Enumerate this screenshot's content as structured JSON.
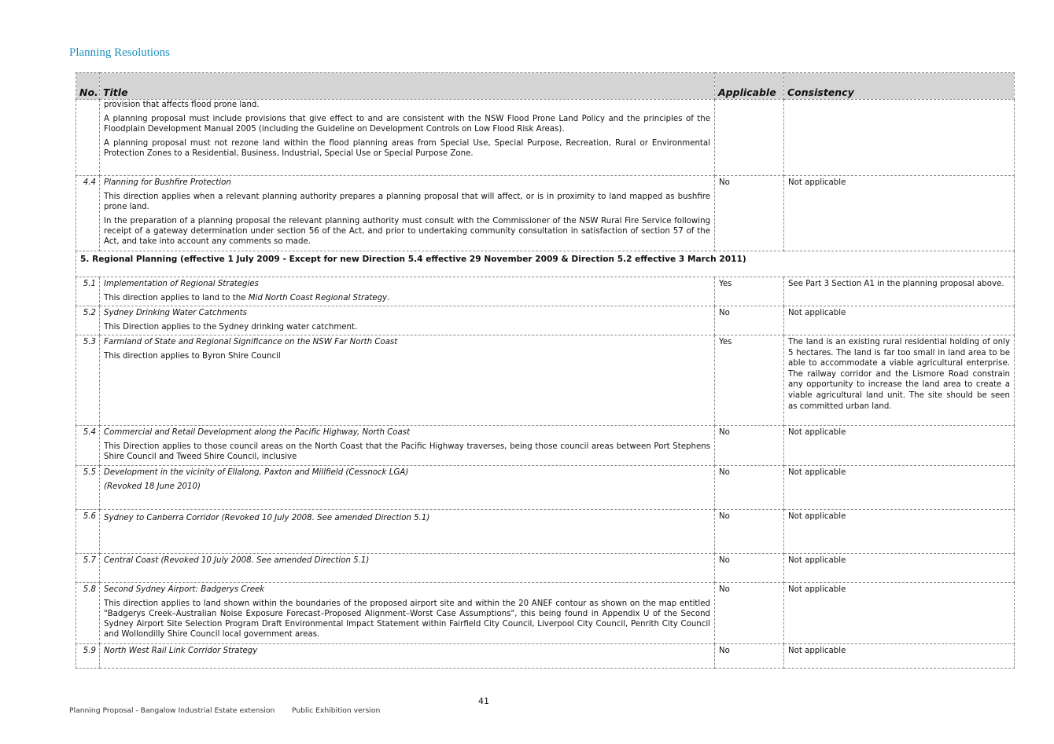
{
  "page_title": "Planning Resolutions",
  "table": {
    "headers": {
      "no": "No.",
      "title": "Title",
      "applicable": "Applicable",
      "consistency": "Consistency"
    },
    "row_cont": {
      "p1": "provision that affects flood prone land.",
      "p2": "A planning proposal must include provisions that give effect to and are consistent with the NSW Flood Prone Land Policy and the principles of the Floodplain Development Manual 2005 (including the Guideline on Development Controls on Low Flood Risk Areas).",
      "p3": "A planning proposal must not rezone land within the flood planning areas from Special Use, Special Purpose, Recreation, Rural or Environmental Protection Zones to a Residential, Business, Industrial, Special Use or Special Purpose Zone."
    },
    "row_4_4": {
      "no": "4.4",
      "heading": "Planning for Bushfire Protection",
      "p1": "This direction applies when a relevant planning authority prepares a planning proposal that will affect, or is in proximity to land mapped as bushfire prone land.",
      "p2": "In the preparation of a planning proposal the relevant planning authority must consult with the Commissioner of the NSW Rural Fire Service following receipt of a gateway determination under section 56 of the Act, and prior to undertaking community consultation in satisfaction of section 57 of the Act, and take into account any comments so made.",
      "applicable": "No",
      "consistency": "Not applicable"
    },
    "section_5": "5. Regional Planning (effective 1 July 2009 - Except for new Direction 5.4 effective 29 November 2009 & Direction 5.2 effective 3 March 2011)",
    "row_5_1": {
      "no": "5.1",
      "heading": "Implementation of Regional Strategies",
      "p1_pre": "This direction applies to land to the ",
      "p1_it": "Mid North Coast Regional Strategy",
      "p1_post": ".",
      "applicable": "Yes",
      "consistency": "See Part 3 Section A1 in the planning proposal above."
    },
    "row_5_2": {
      "no": "5.2",
      "heading": "Sydney Drinking Water Catchments",
      "p1": "This Direction applies to the Sydney drinking water catchment.",
      "applicable": "No",
      "consistency": "Not applicable"
    },
    "row_5_3": {
      "no": "5.3",
      "heading": "Farmland of State and Regional Significance on the NSW Far North Coast",
      "p1": "This direction applies to Byron Shire Council",
      "applicable": "Yes",
      "consistency": "The land is an existing rural residential holding of only 5 hectares. The land is far too small in land area to be able to accommodate a viable agricultural enterprise. The railway corridor and the Lismore Road constrain any opportunity to increase the land area to create a viable agricultural land unit. The site should be seen as committed urban land."
    },
    "row_5_4": {
      "no": "5.4",
      "heading": "Commercial and Retail Development along the Pacific Highway, North Coast",
      "p1": "This Direction applies to those council areas on the North Coast that the Pacific Highway traverses, being those council areas between Port Stephens Shire Council and Tweed Shire Council, inclusive",
      "applicable": "No",
      "consistency": "Not applicable"
    },
    "row_5_5": {
      "no": "5.5",
      "heading": "Development in the vicinity of Ellalong, Paxton and Millfield (Cessnock LGA)",
      "p1": "(Revoked 18 June 2010)",
      "applicable": "No",
      "consistency": "Not applicable"
    },
    "row_5_6": {
      "no": "5.6",
      "heading": "Sydney to Canberra Corridor (Revoked 10 July 2008. See amended Direction 5.1)",
      "applicable": "No",
      "consistency": "Not applicable"
    },
    "row_5_7": {
      "no": "5.7",
      "heading": "Central Coast (Revoked 10 July 2008. See amended Direction 5.1)",
      "applicable": "No",
      "consistency": "Not applicable"
    },
    "row_5_8": {
      "no": "5.8",
      "heading": "Second Sydney Airport: Badgerys Creek",
      "p1": "This direction applies to land shown within the boundaries of the proposed airport site and within the 20 ANEF contour as shown on the map entitled \"Badgerys Creek–Australian Noise Exposure Forecast–Proposed Alignment–Worst Case Assumptions\", this being found in Appendix U of the Second Sydney Airport Site Selection Program Draft Environmental Impact Statement within Fairfield City Council, Liverpool City Council, Penrith City Council and Wollondilly Shire Council local government areas.",
      "applicable": "No",
      "consistency": "Not applicable"
    },
    "row_5_9": {
      "no": "5.9",
      "heading": "North West Rail Link Corridor Strategy",
      "applicable": "No",
      "consistency": "Not applicable"
    }
  },
  "page_number": "41",
  "footer": {
    "left": "Planning Proposal - Bangalow Industrial Estate extension",
    "right": "Public Exhibition version"
  }
}
